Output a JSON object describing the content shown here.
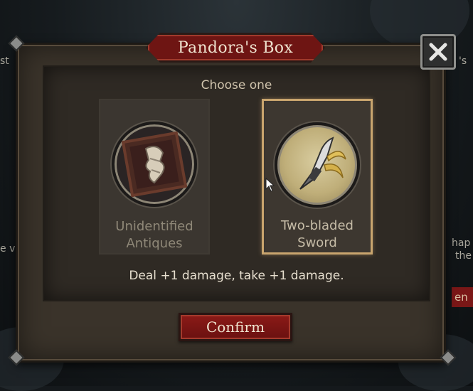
{
  "dialog": {
    "title": "Pandora's Box",
    "subtitle": "Choose one",
    "options": [
      {
        "label_line1": "Unidentified",
        "label_line2": "Antiques",
        "icon": "antique-relic-icon",
        "selected": false
      },
      {
        "label_line1": "Two-bladed",
        "label_line2": "Sword",
        "icon": "two-bladed-sword-icon",
        "selected": true
      }
    ],
    "description": "Deal +1 damage,  take +1 damage.",
    "confirm_label": "Confirm",
    "close_icon": "close-icon"
  },
  "background": {
    "left_text_1": "st",
    "left_text_2": "e v",
    "right_text_1": "'s",
    "right_text_2": "hap",
    "right_text_3": "the",
    "right_button": "en"
  },
  "colors": {
    "accent_red": "#7a1513",
    "selected_border": "#c9a56e",
    "panel": "#3a332a"
  }
}
